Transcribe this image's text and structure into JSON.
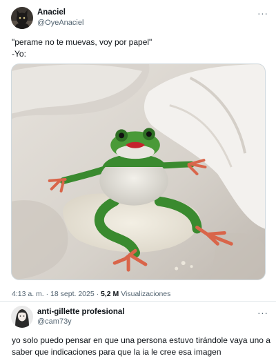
{
  "tweet1": {
    "author_name": "Anaciel",
    "author_handle": "@OyeAnaciel",
    "more_glyph": "···",
    "text_line1": "\"perame no te muevas, voy por papel\"",
    "text_line2": "-Yo:",
    "time": "4:13 a. m.",
    "separator": "·",
    "date": "18 sept. 2025",
    "views_count": "5,2 M",
    "views_label": "Visualizaciones",
    "media_icon": "frog-on-bed-photo"
  },
  "tweet2": {
    "author_name": "anti-gillette profesional",
    "author_handle": "@cam73y",
    "more_glyph": "···",
    "text_line1": "yo solo puedo pensar en que una persona estuvo tirándole vaya uno a",
    "text_line2": "saber que indicaciones para que la ia le cree esa imagen"
  },
  "colors": {
    "text_primary": "#0f1419",
    "text_secondary": "#536471",
    "border": "#cfd9de"
  }
}
